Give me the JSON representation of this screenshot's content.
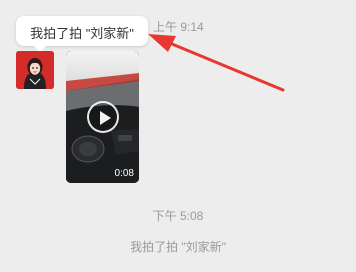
{
  "tooltip": {
    "text": "我拍了拍 \"刘家新\""
  },
  "messages": {
    "time_top": "上午 9:14",
    "video_duration": "0:08",
    "time_mid": "下午 5:08",
    "system_notice": "我拍了拍 \"刘家新\""
  },
  "icons": {
    "avatar": "user-avatar-icon",
    "play": "play-icon",
    "annotation": "red-arrow-icon"
  },
  "colors": {
    "background": "#ededed",
    "avatar_bg": "#d42b2b",
    "arrow": "#e8382f",
    "muted_text": "#9a9a9a"
  }
}
